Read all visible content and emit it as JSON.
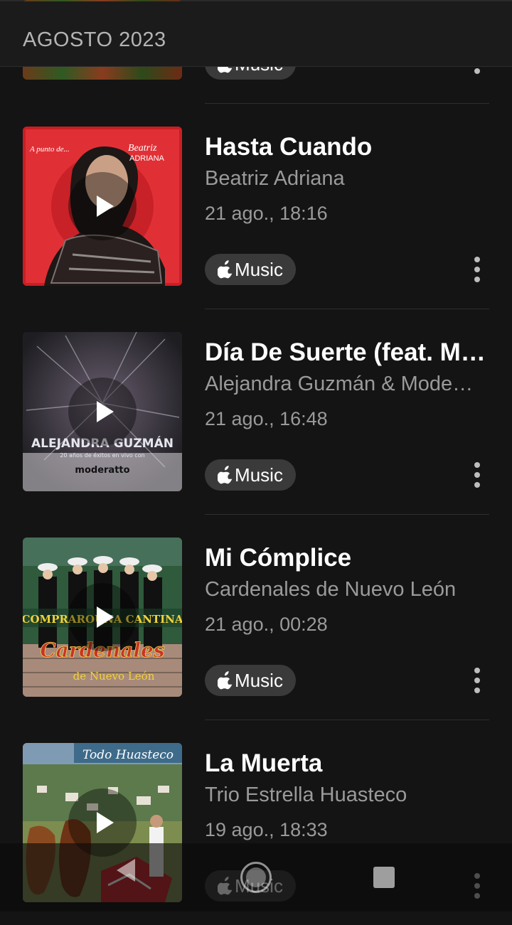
{
  "header": {
    "section_label": "AGOSTO 2023"
  },
  "badge": {
    "label": "Music",
    "service": "Apple Music"
  },
  "items": [
    {
      "title": "Hasta Cuando",
      "artist": "Beatriz Adriana",
      "time": "21 ago., 18:16",
      "art": {
        "text_top": "A punto de...",
        "text_name": "Beatriz ADRIANA",
        "colors": [
          "#e0262b",
          "#1a1a1a"
        ]
      }
    },
    {
      "title": "Día De Suerte (feat. M…",
      "artist": "Alejandra Guzmán & Mode…",
      "time": "21 ago., 16:48",
      "art": {
        "text_name": "ALEJANDRA GUZMÁN",
        "text_sub": "20 años de éxitos en vivo con",
        "text_logo": "moderatto",
        "colors": [
          "#3b3b3b",
          "#c9c9c9"
        ]
      }
    },
    {
      "title": "Mi Cómplice",
      "artist": "Cardenales de Nuevo León",
      "time": "21 ago., 00:28",
      "art": {
        "text_top": "COMPRAROUNA CANTINA",
        "text_name": "Cardenales",
        "text_sub": "de Nuevo León",
        "colors": [
          "#3b6d4a",
          "#b43b2c"
        ]
      }
    },
    {
      "title": "La Muerta",
      "artist": "Trio Estrella Huasteco",
      "time": "19 ago., 18:33",
      "art": {
        "text_top": "Todo Huasteco",
        "colors": [
          "#6a8aa8",
          "#5b7a3a"
        ]
      }
    }
  ],
  "navbar": {
    "buttons": [
      "back",
      "home",
      "recents"
    ]
  }
}
